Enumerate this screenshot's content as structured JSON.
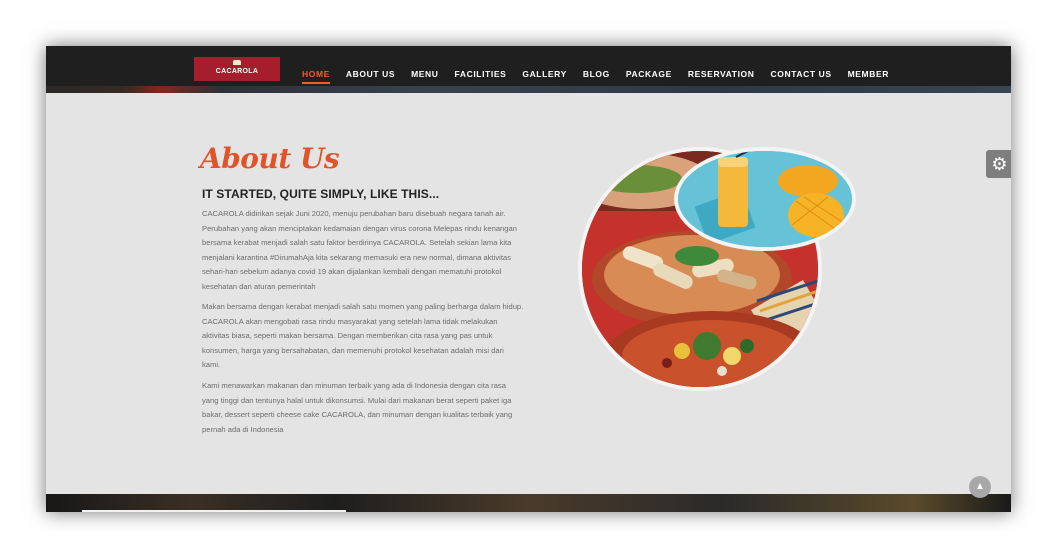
{
  "brand": {
    "name": "CACAROLA",
    "color": "#a41e2e"
  },
  "nav": {
    "items": [
      "HOME",
      "ABOUT US",
      "MENU",
      "FACILITIES",
      "GALLERY",
      "BLOG",
      "PACKAGE",
      "RESERVATION",
      "CONTACT US",
      "MEMBER"
    ],
    "active": "HOME",
    "accent_color": "#e8612c"
  },
  "about": {
    "title": "About Us",
    "subtitle": "IT STARTED, QUITE SIMPLY, LIKE THIS...",
    "paragraphs": [
      "CACAROLA didirikan sejak Juni 2020, menuju perubahan baru disebuah negara tanah air. Perubahan yang akan menciptakan kedamaian dengan virus corona Melepas rindu kenangan bersama kerabat menjadi salah satu faktor berdirinya CACAROLA. Setelah sekian lama kita menjalani karantina #DirumahAja kita sekarang memasuki era new normal, dimana aktivitas sehari-hari sebelum adanya covid 19 akan dijalankan kembali dengan mematuhi protokol kesehatan dan aturan pemerintah",
      "Makan bersama dengan kerabat menjadi salah satu momen yang paling berharga dalam hidup. CACAROLA akan mengobati rasa rindu masyarakat yang setelah lama tidak melakukan aktivitas biasa, seperti makan bersama. Dengan memberikan cita rasa yang pas untuk konsumen, harga yang bersahabatan, dan memenuhi protokol kesehatan adalah misi dari kami.",
      "Kami menawarkan makanan dan minuman terbaik yang ada di Indonesia dengan cita rasa yang tinggi dan tentunya halal untuk dikonsumsi. Mulai dari makanan berat seperti paket iga bakar, dessert seperti cheese cake CACAROLA, dan minuman dengan kualitas terbaik yang pernah ada di Indonesia"
    ]
  },
  "icons": {
    "settings": "gear-icon",
    "back_to_top": "chevron-up-icon"
  },
  "colors": {
    "title": "#e0542a",
    "background": "#e4e4e4",
    "navbar": "#1f1f1f"
  }
}
